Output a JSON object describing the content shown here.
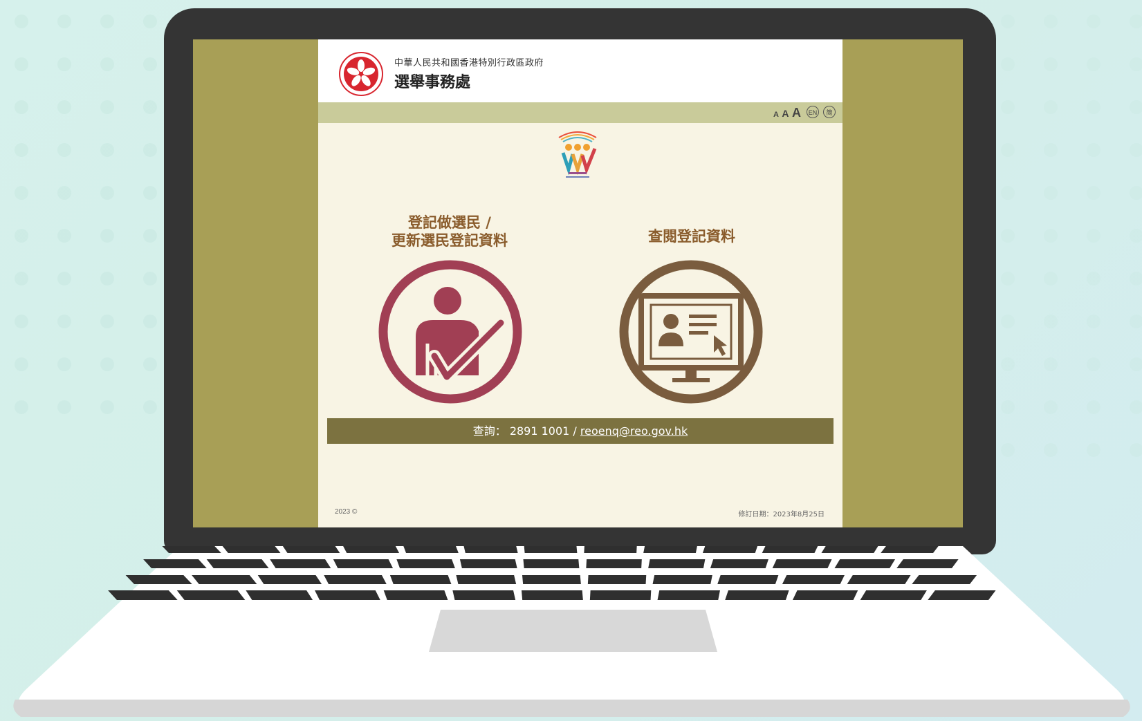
{
  "header": {
    "gov_name": "中華人民共和國香港特別行政區政府",
    "dept_name": "選舉事務處"
  },
  "toolbar": {
    "font_small": "A",
    "font_medium": "A",
    "font_large": "A",
    "lang_en": "EN",
    "lang_sc": "简"
  },
  "options": [
    {
      "title_line1": "登記做選民 /",
      "title_line2": "更新選民登記資料"
    },
    {
      "title": "查閱登記資料"
    }
  ],
  "enquiry": {
    "label": "查詢： 2891 1001 / ",
    "email": "reoenq@reo.gov.hk"
  },
  "footer": {
    "copyright": "2023 ©",
    "revision": "修訂日期：2023年8月25日"
  },
  "colors": {
    "screen_bg": "#a89f56",
    "page_bg": "#f8f4e4",
    "toolbar_bg": "#c9cb9a",
    "enquiry_bg": "#7c7240",
    "register_icon": "#a13f54",
    "check_icon": "#7a5c3e",
    "title_text": "#8a5c2c"
  }
}
